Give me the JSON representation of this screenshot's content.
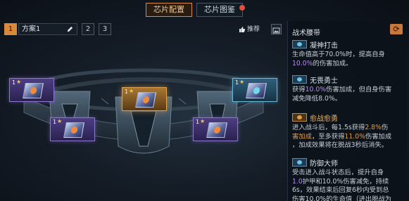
{
  "tabs": [
    {
      "label": "芯片配置",
      "active": true
    },
    {
      "label": "芯片图鉴",
      "active": false,
      "has_notification": true
    }
  ],
  "scheme": {
    "current_index": "1",
    "current_name": "方案1",
    "other_indices": [
      "2",
      "3"
    ]
  },
  "toolbar": {
    "recommend_label": "推荐"
  },
  "panel": {
    "title": "战术腰带",
    "tactics": [
      {
        "name": "凝神打击",
        "desc_1": "生命值高于70.0%时，提高自身",
        "desc_2_hl": "10.0%",
        "desc_2": "的伤害加成。",
        "tier": "cyan"
      },
      {
        "name": "无畏勇士",
        "desc_1a": "获得",
        "desc_1b_hl": "10.0%",
        "desc_1c": "伤害加成，但自身伤害",
        "desc_2": "减免降低8.0%。",
        "tier": "cyan"
      },
      {
        "name": "愈战愈勇",
        "desc_1a": "进入战斗后，每1.5s获得",
        "desc_1b_hl": "2.8%",
        "desc_1c": "伤",
        "desc_2a_hl": "害加成",
        "desc_2b": "，至多获得",
        "desc_2c_hl": "11.0%",
        "desc_2d": "伤害加成",
        "desc_3": "，加成效果将在脱战3秒后消失。",
        "tier": "gold"
      },
      {
        "name": "防御大师",
        "desc_1": "受击进入战斗状态后，提升自身",
        "desc_2a_hl": "1.0",
        "desc_2b": "护甲和10.0%伤害减免，持续",
        "desc_3": "6s，效果结束后回复6秒内受到总",
        "desc_4": "伤害10.0%的生命值（进出脱战为",
        "tier": "cyan"
      }
    ]
  },
  "chips": [
    {
      "level": "1",
      "tier": "purple"
    },
    {
      "level": "1",
      "tier": "purple"
    },
    {
      "level": "1",
      "tier": "gold"
    },
    {
      "level": "1",
      "tier": "purple"
    },
    {
      "level": "1",
      "tier": "cyan"
    }
  ],
  "colors": {
    "accent_orange": "#d88a3c",
    "highlight_purple": "#b58cf0",
    "highlight_orange": "#e39a47",
    "notification_red": "#e0513b"
  },
  "icons": [
    "edit-icon",
    "thumbs-up-icon",
    "image-icon",
    "refresh-icon",
    "star-icon"
  ]
}
